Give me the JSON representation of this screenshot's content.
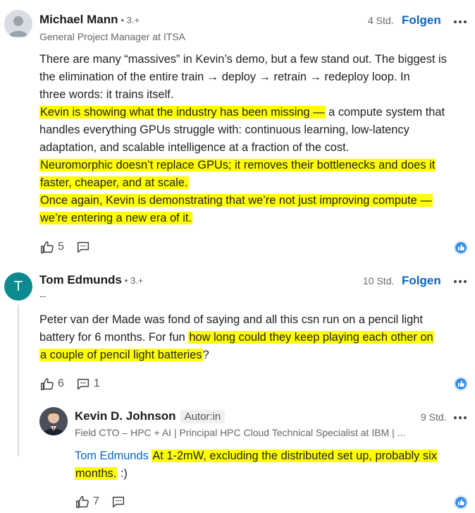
{
  "comments": [
    {
      "name": "Michael Mann",
      "degree": "• 3.+",
      "headline": "General Project Manager at ITSA",
      "time": "4 Std.",
      "follow": "Folgen",
      "lines": [
        [
          {
            "t": "There are many “massives” in Kevin’s demo, but a few stand out. The biggest is",
            "h": false
          }
        ],
        [
          {
            "t": "the elimination of the entire train → deploy → retrain → redeploy loop. In",
            "h": false
          }
        ],
        [
          {
            "t": "three words: it trains itself.",
            "h": false
          }
        ],
        [
          {
            "t": "Kevin is showing what the industry has been missing —",
            "h": true
          },
          {
            "t": " a compute system that",
            "h": false
          }
        ],
        [
          {
            "t": "handles everything GPUs struggle with: continuous learning, low-latency",
            "h": false
          }
        ],
        [
          {
            "t": "adaptation, and scalable intelligence at a fraction of the cost.",
            "h": false
          }
        ],
        [
          {
            "t": "Neuromorphic doesn’t replace GPUs; it removes their bottlenecks and does it",
            "h": true
          }
        ],
        [
          {
            "t": "faster, cheaper, and at scale.",
            "h": true
          }
        ],
        [
          {
            "t": "Once again, Kevin is demonstrating that we’re not just improving compute —",
            "h": true
          }
        ],
        [
          {
            "t": "we’re entering a new era of it.",
            "h": true
          }
        ]
      ],
      "likes": "5",
      "replies": ""
    },
    {
      "name": "Tom Edmunds",
      "avatar_letter": "T",
      "degree": "• 3.+",
      "headline": "--",
      "time": "10 Std.",
      "follow": "Folgen",
      "lines": [
        [
          {
            "t": "Peter van der Made was fond of saying and all this csn run on a pencil light",
            "h": false
          }
        ],
        [
          {
            "t": "battery for 6 months. For fun ",
            "h": false
          },
          {
            "t": "how long could they keep playing each other on",
            "h": true
          }
        ],
        [
          {
            "t": "a couple of pencil light batteries",
            "h": true
          },
          {
            "t": "?",
            "h": false
          }
        ]
      ],
      "likes": "6",
      "replies": "1"
    },
    {
      "name": "Kevin D. Johnson",
      "author_tag": "Autor:in",
      "headline": "Field CTO – HPC + AI | Principal HPC Cloud Technical Specialist at IBM | ...",
      "time": "9 Std.",
      "mention": "Tom Edmunds",
      "lines": [
        [
          {
            "t": "At 1-2mW, excluding the distributed set up, probably six",
            "h": true
          }
        ],
        [
          {
            "t": "months.",
            "h": true
          },
          {
            "t": "  :)",
            "h": false
          }
        ]
      ],
      "likes": "7",
      "replies": ""
    }
  ],
  "colors": {
    "accent": "#0a66c2",
    "highlight": "#ffff00",
    "tom_avatar": "#0b8a8f",
    "reaction": "#378fe9"
  },
  "icons": [
    "like-icon",
    "comment-icon",
    "more-icon",
    "reaction-like-badge"
  ]
}
